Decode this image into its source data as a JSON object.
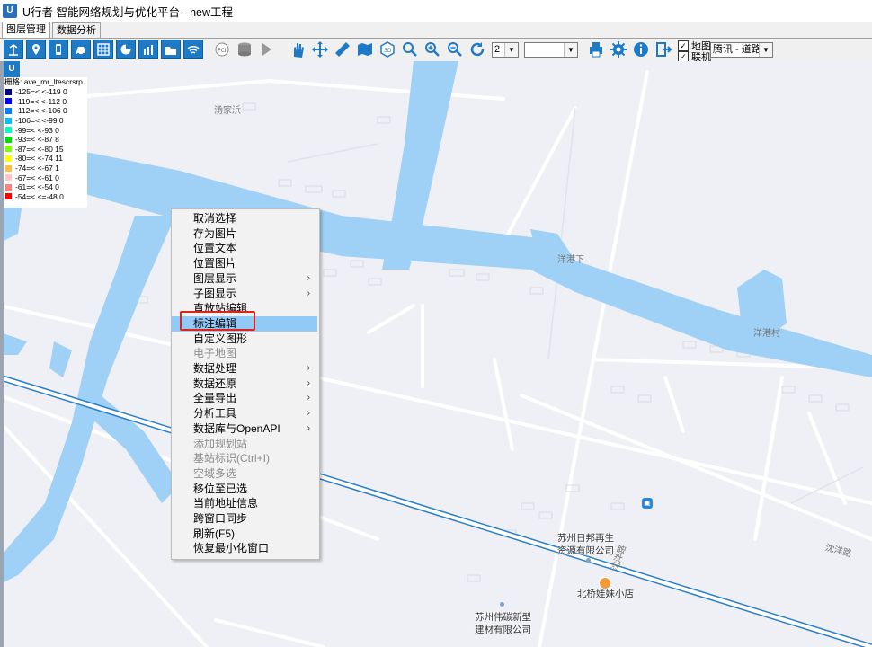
{
  "window": {
    "title": "U行者 智能网络规划与优化平台 - new工程",
    "icon": "app-logo-icon"
  },
  "tabs": [
    {
      "label": "图层管理",
      "active": true
    },
    {
      "label": "数据分析",
      "active": false
    }
  ],
  "toolbar": {
    "combo1_value": "2",
    "combo2_value": "",
    "combo3_value": "腾讯 - 道路",
    "check_map_label": "地图",
    "check_online_label": "联机",
    "check_map_checked": true,
    "check_online_checked": true
  },
  "legend": {
    "title": "栅格: ave_mr_ltescrsrp",
    "items": [
      {
        "label": "-125=< <-119 0",
        "color": "#000080"
      },
      {
        "label": "-119=< <-112 0",
        "color": "#0000ff"
      },
      {
        "label": "-112=< <-106 0",
        "color": "#0080ff"
      },
      {
        "label": "-106=< <-99 0",
        "color": "#00c0ff"
      },
      {
        "label": "-99=< <-93 0",
        "color": "#00ffc0"
      },
      {
        "label": "-93=< <-87 8",
        "color": "#00e000"
      },
      {
        "label": "-87=< <-80 15",
        "color": "#80ff00"
      },
      {
        "label": "-80=< <-74 11",
        "color": "#ffff00"
      },
      {
        "label": "-74=< <-67 1",
        "color": "#ffc040"
      },
      {
        "label": "-67=< <-61 0",
        "color": "#ffc8c8"
      },
      {
        "label": "-61=< <-54 0",
        "color": "#ff8080"
      },
      {
        "label": "-54=< <=-48 0",
        "color": "#ff0000"
      }
    ]
  },
  "map_labels": {
    "label1": "汤家浜",
    "label2": "洋港下",
    "label3": "洋港村",
    "label4": "苏州日邦再生",
    "label4b": "资源有限公司",
    "label5": "北桥娃妹小店",
    "label6": "苏州伟碳新型",
    "label6b": "建材有限公司",
    "label7": "沈洋路",
    "label8": "沈洋路"
  },
  "context_menu": [
    {
      "label": "取消选择",
      "disabled": false,
      "submenu": false
    },
    {
      "label": "存为图片",
      "disabled": false,
      "submenu": false
    },
    {
      "label": "位置文本",
      "disabled": false,
      "submenu": false
    },
    {
      "label": "位置图片",
      "disabled": false,
      "submenu": false
    },
    {
      "label": "图层显示",
      "disabled": false,
      "submenu": true
    },
    {
      "label": "子图显示",
      "disabled": false,
      "submenu": true
    },
    {
      "label": "直放站编辑",
      "disabled": false,
      "submenu": false
    },
    {
      "label": "标注编辑",
      "disabled": false,
      "submenu": false,
      "hover": true
    },
    {
      "label": "自定义图形",
      "disabled": false,
      "submenu": false
    },
    {
      "label": "电子地图",
      "disabled": true,
      "submenu": false
    },
    {
      "label": "数据处理",
      "disabled": false,
      "submenu": true
    },
    {
      "label": "数据还原",
      "disabled": false,
      "submenu": true
    },
    {
      "label": "全量导出",
      "disabled": false,
      "submenu": true
    },
    {
      "label": "分析工具",
      "disabled": false,
      "submenu": true
    },
    {
      "label": "数据库与OpenAPI",
      "disabled": false,
      "submenu": true
    },
    {
      "label": "添加规划站",
      "disabled": true,
      "submenu": false
    },
    {
      "label": "基站标识(Ctrl+I)",
      "disabled": true,
      "submenu": false
    },
    {
      "label": "空域多选",
      "disabled": true,
      "submenu": false
    },
    {
      "label": "移位至已选",
      "disabled": false,
      "submenu": false
    },
    {
      "label": "当前地址信息",
      "disabled": false,
      "submenu": false
    },
    {
      "label": "跨窗口同步",
      "disabled": false,
      "submenu": false
    },
    {
      "label": "刷新(F5)",
      "disabled": false,
      "submenu": false
    },
    {
      "label": "恢复最小化窗口",
      "disabled": false,
      "submenu": false
    }
  ],
  "colors": {
    "water": "#9fd0f5",
    "road": "#ffffff",
    "map_bg": "#eef0f5",
    "menu_hover": "#91c9f7",
    "highlight_box": "#e0241b",
    "toolbar_blue": "#1f7ac6"
  }
}
